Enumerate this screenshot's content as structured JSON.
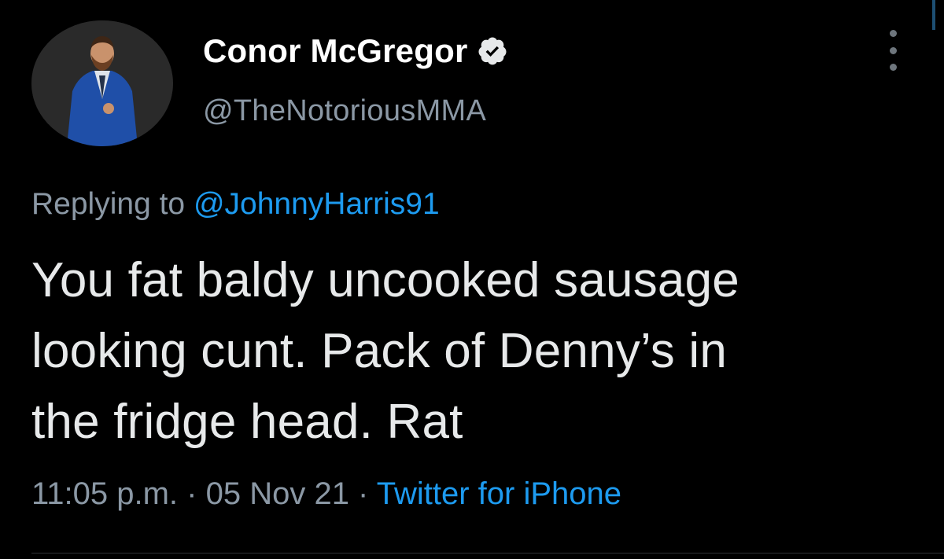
{
  "tweet": {
    "author": {
      "display_name": "Conor McGregor",
      "handle": "@TheNotoriousMMA",
      "verified": true,
      "avatar_icon": "profile-photo"
    },
    "reply": {
      "prefix": "Replying to ",
      "mention": "@JohnnyHarris91"
    },
    "text_lines": [
      "You fat baldy uncooked sausage",
      "looking cunt. Pack of Denny’s in",
      "the fridge head. Rat"
    ],
    "meta": {
      "time": "11:05 p.m.",
      "separator": " · ",
      "date": "05 Nov 21",
      "source": "Twitter for iPhone"
    }
  },
  "colors": {
    "background": "#000000",
    "primary_text": "#e7e9ea",
    "secondary_text": "#8b98a5",
    "link": "#1d9bf0"
  }
}
